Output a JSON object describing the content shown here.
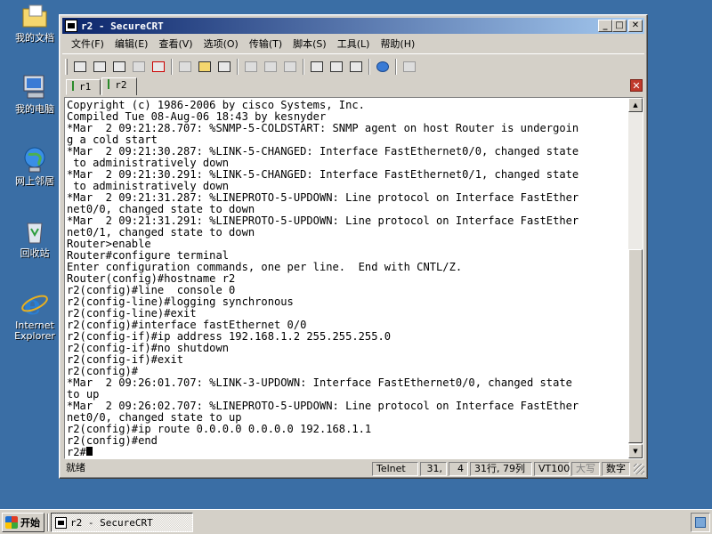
{
  "desktop": {
    "icons": [
      {
        "label": "我的文档",
        "icon": "my-documents-icon"
      },
      {
        "label": "我的电脑",
        "icon": "my-computer-icon"
      },
      {
        "label": "网上邻居",
        "icon": "network-places-icon"
      },
      {
        "label": "回收站",
        "icon": "recycle-bin-icon"
      },
      {
        "label": "Internet Explorer",
        "icon": "internet-explorer-icon"
      }
    ]
  },
  "window": {
    "title": "r2 - SecureCRT",
    "minimize": "_",
    "maximize": "□",
    "close": "✕"
  },
  "menu": {
    "items": [
      "文件(F)",
      "编辑(E)",
      "查看(V)",
      "选项(O)",
      "传输(T)",
      "脚本(S)",
      "工具(L)",
      "帮助(H)"
    ]
  },
  "tabs": {
    "items": [
      {
        "label": "r1",
        "active": false
      },
      {
        "label": "r2",
        "active": true
      }
    ],
    "close": "✕"
  },
  "terminal": {
    "lines": [
      "Copyright (c) 1986-2006 by cisco Systems, Inc.",
      "Compiled Tue 08-Aug-06 18:43 by kesnyder",
      "*Mar  2 09:21:28.707: %SNMP-5-COLDSTART: SNMP agent on host Router is undergoin",
      "g a cold start",
      "*Mar  2 09:21:30.287: %LINK-5-CHANGED: Interface FastEthernet0/0, changed state",
      " to administratively down",
      "*Mar  2 09:21:30.291: %LINK-5-CHANGED: Interface FastEthernet0/1, changed state",
      " to administratively down",
      "*Mar  2 09:21:31.287: %LINEPROTO-5-UPDOWN: Line protocol on Interface FastEther",
      "net0/0, changed state to down",
      "*Mar  2 09:21:31.291: %LINEPROTO-5-UPDOWN: Line protocol on Interface FastEther",
      "net0/1, changed state to down",
      "Router>enable",
      "Router#configure terminal",
      "Enter configuration commands, one per line.  End with CNTL/Z.",
      "Router(config)#hostname r2",
      "r2(config)#line  console 0",
      "r2(config-line)#logging synchronous",
      "r2(config-line)#exit",
      "r2(config)#interface fastEthernet 0/0",
      "r2(config-if)#ip address 192.168.1.2 255.255.255.0",
      "r2(config-if)#no shutdown",
      "r2(config-if)#exit",
      "r2(config)#",
      "*Mar  2 09:26:01.707: %LINK-3-UPDOWN: Interface FastEthernet0/0, changed state",
      "to up",
      "*Mar  2 09:26:02.707: %LINEPROTO-5-UPDOWN: Line protocol on Interface FastEther",
      "net0/0, changed state to up",
      "r2(config)#ip route 0.0.0.0 0.0.0.0 192.168.1.1",
      "r2(config)#end",
      "r2#"
    ]
  },
  "status": {
    "ready": "就绪",
    "protocol": "Telnet",
    "row": "31,",
    "col": "4",
    "size": "31行, 79列",
    "emulation": "VT100",
    "caps": "大写",
    "num": "数字"
  },
  "taskbar": {
    "start": "开始",
    "task": "r2 - SecureCRT"
  }
}
